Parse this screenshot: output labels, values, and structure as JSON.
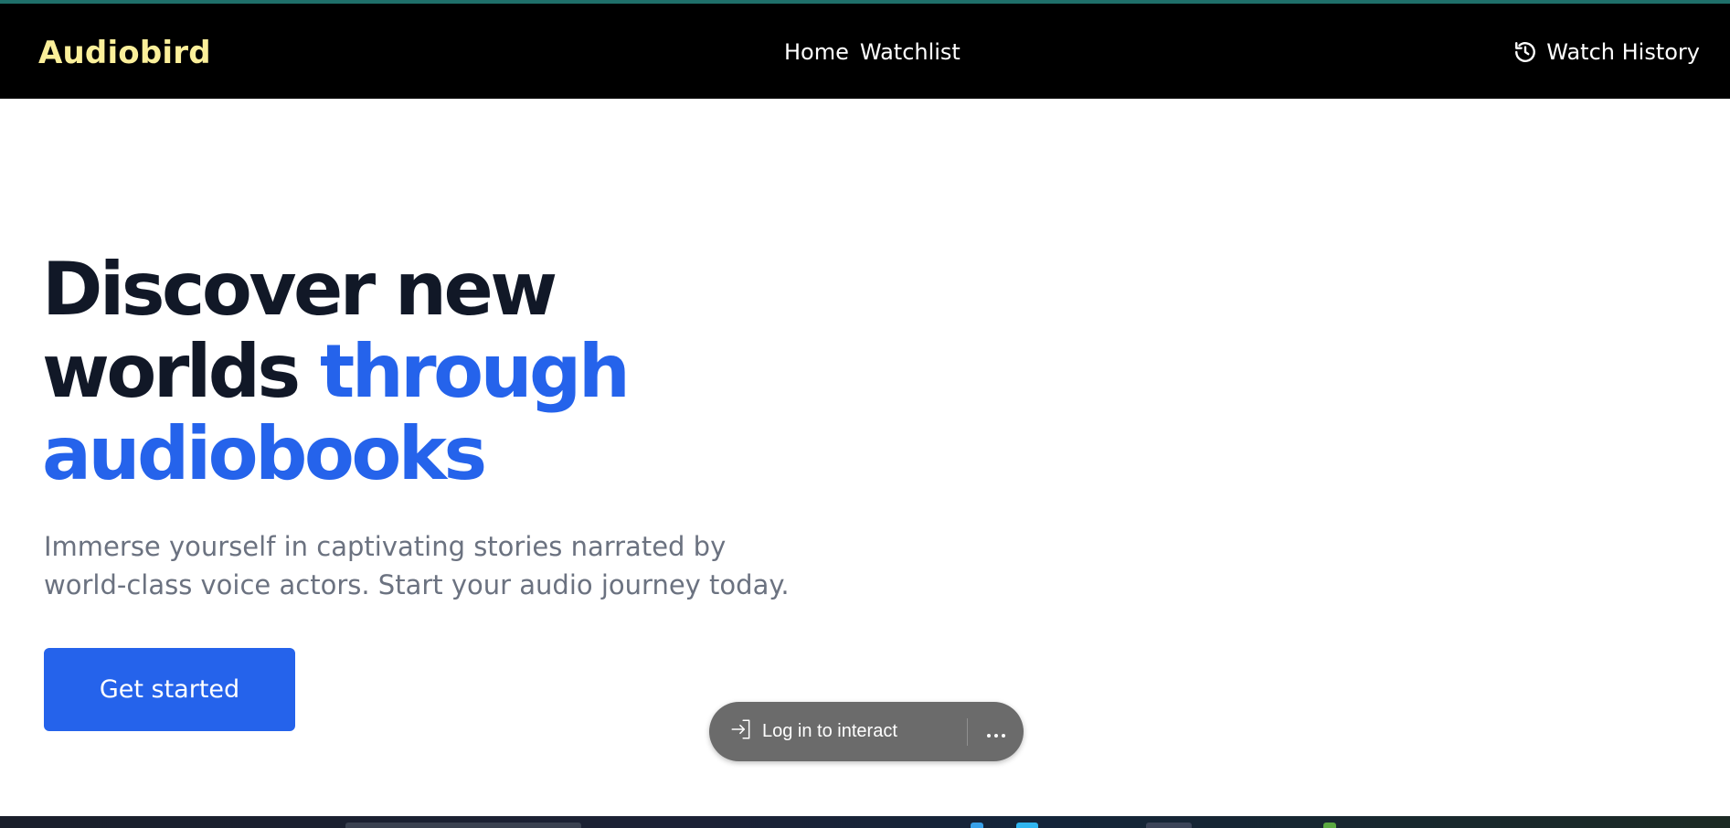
{
  "app": {
    "brand": "Audiobird"
  },
  "nav": {
    "links": [
      {
        "label": "Home"
      },
      {
        "label": "Watchlist"
      }
    ],
    "history": {
      "label": "Watch History",
      "icon": "history-icon"
    }
  },
  "hero": {
    "title_line1": "Discover new",
    "title_line2_dark": "worlds",
    "title_line2_accent": "through",
    "title_line3_accent": "audiobooks",
    "subtitle_line1": "Immerse yourself in captivating stories narrated by",
    "subtitle_line2": "world-class voice actors. Start your audio journey today.",
    "cta_label": "Get started"
  },
  "overlay": {
    "login_label": "Log in to interact",
    "login_icon": "sign-in-icon",
    "more_icon": "more-horizontal-icon"
  },
  "colors": {
    "brand": "#fbef9a",
    "accent": "#2563eb",
    "heading": "#111827",
    "muted": "#6b7280",
    "navbar": "#000000"
  }
}
